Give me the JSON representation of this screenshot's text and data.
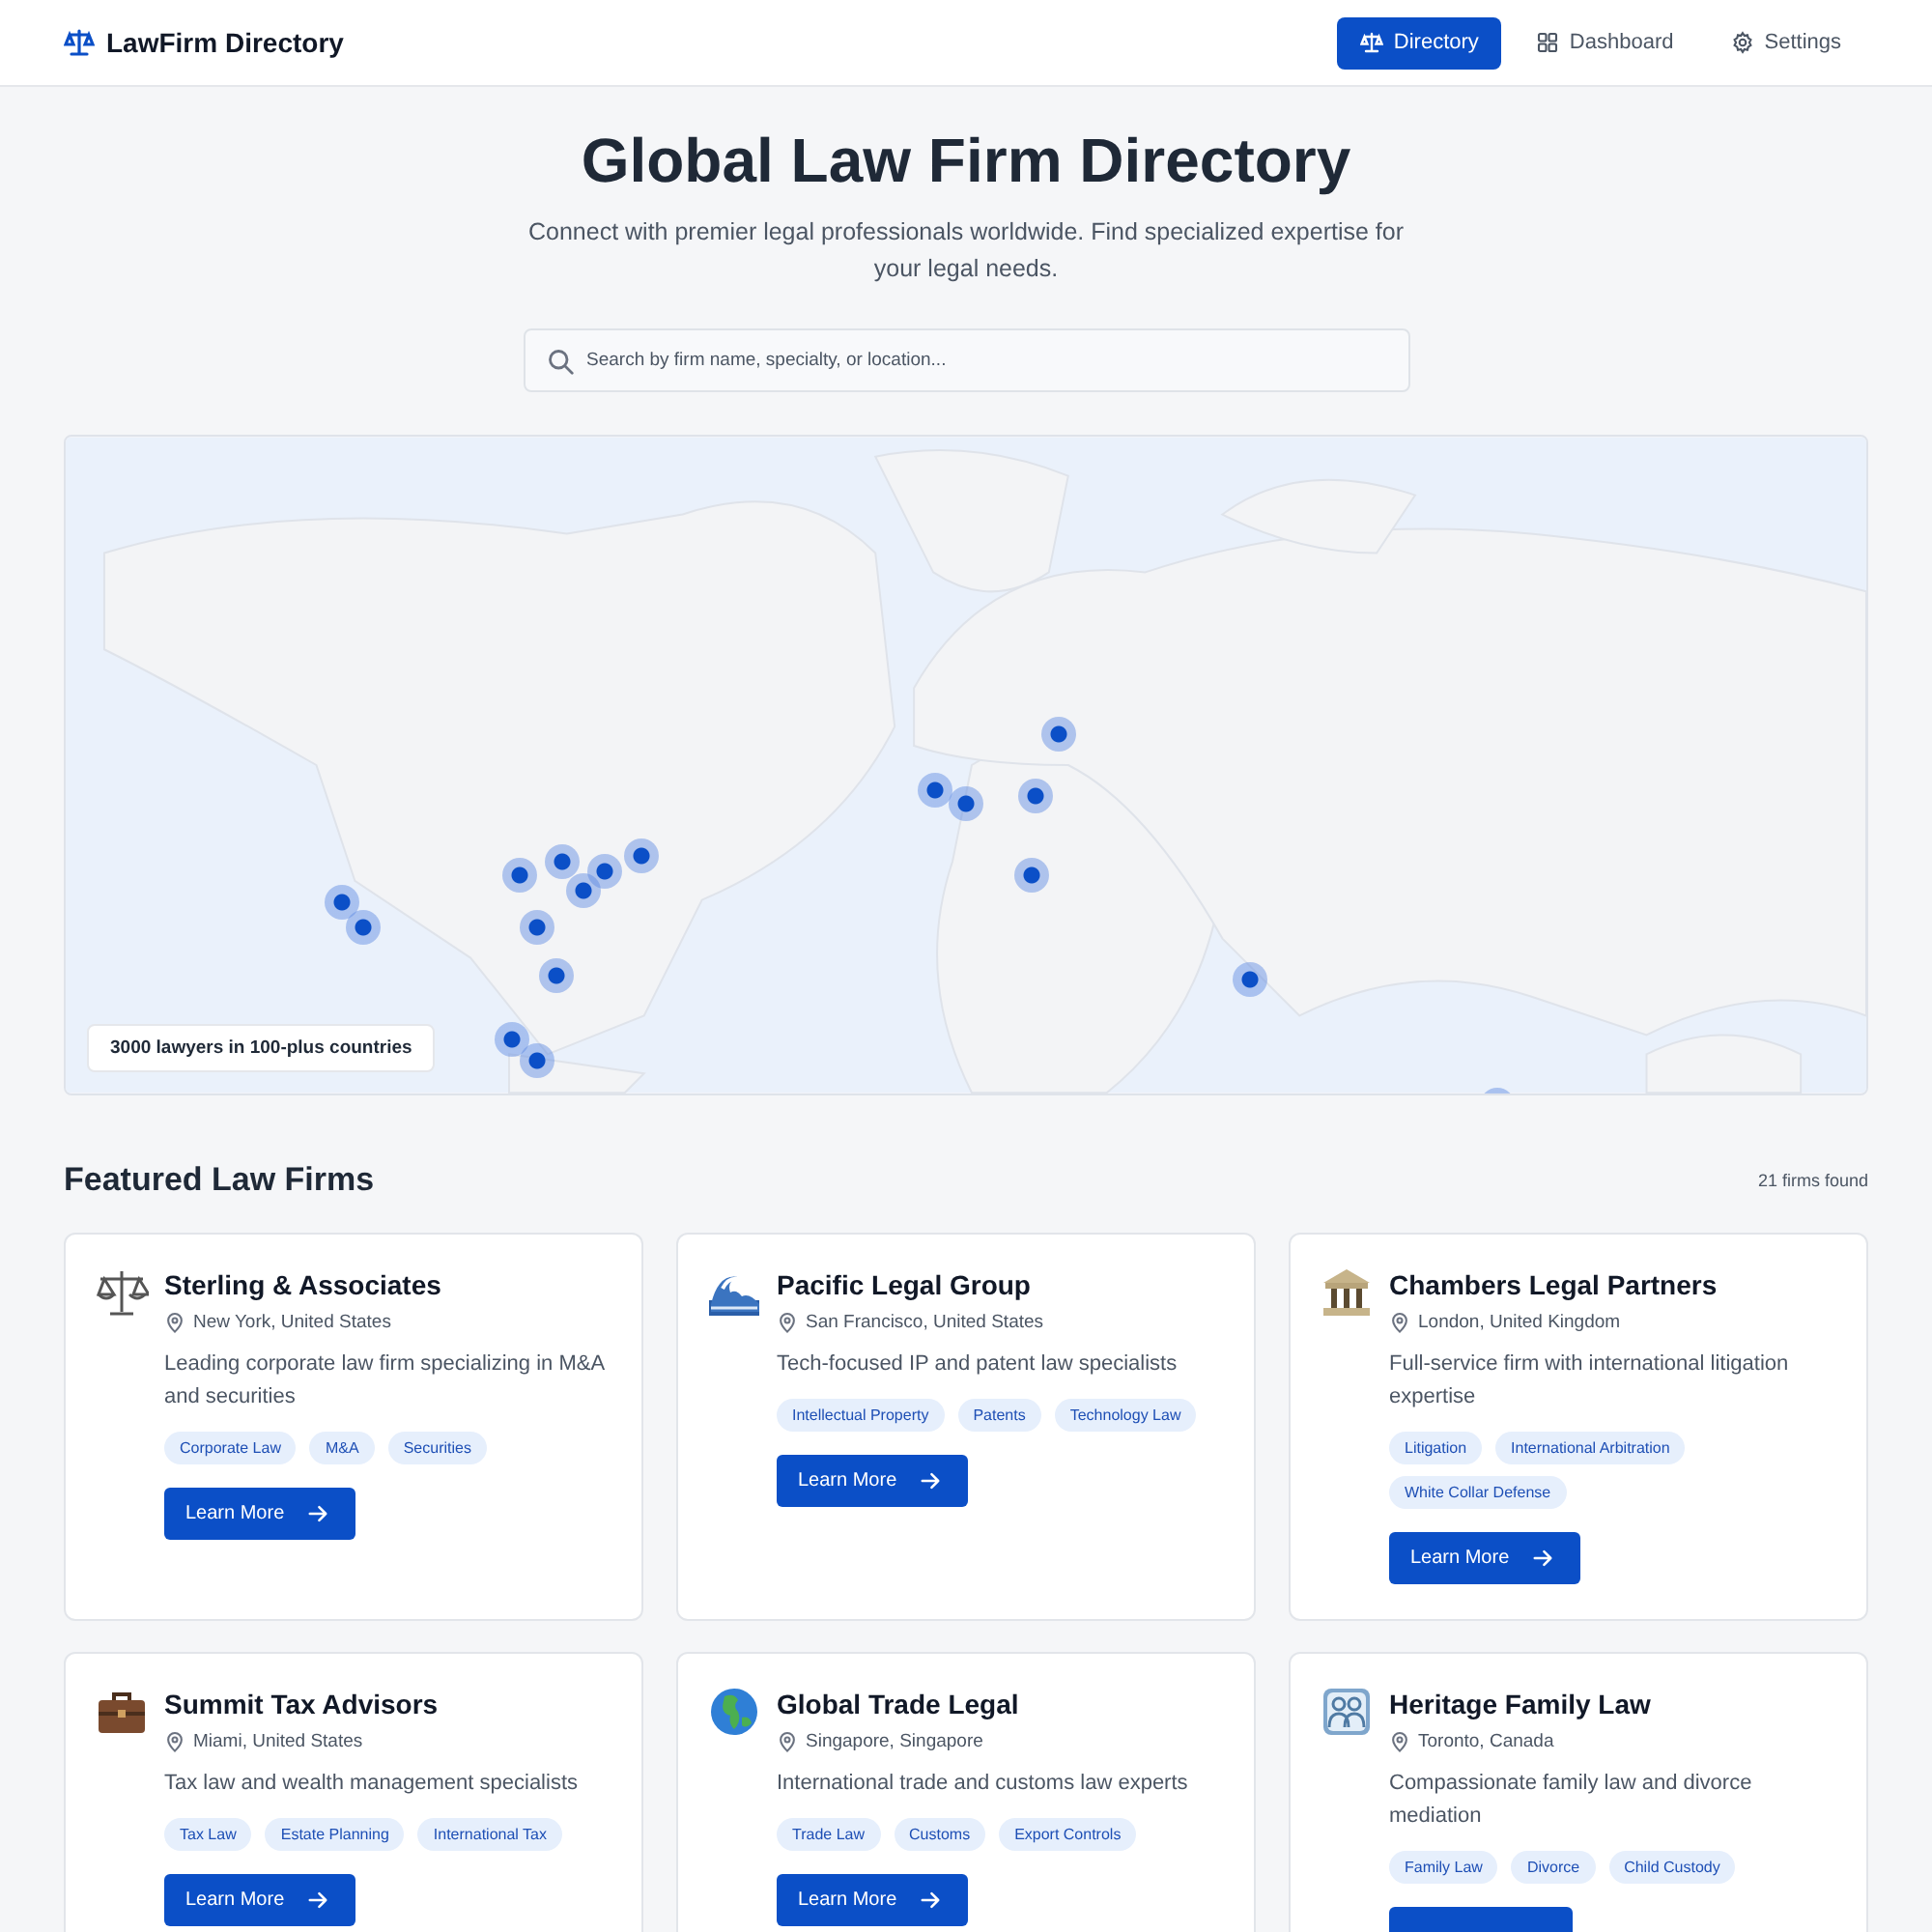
{
  "header": {
    "brand": "LawFirm Directory",
    "nav": [
      {
        "label": "Directory",
        "selected": true
      },
      {
        "label": "Dashboard",
        "selected": false
      },
      {
        "label": "Settings",
        "selected": false
      }
    ]
  },
  "hero": {
    "title": "Global Law Firm Directory",
    "subtitle": "Connect with premier legal professionals worldwide. Find specialized expertise for your legal needs."
  },
  "search": {
    "placeholder": "Search by firm name, specialty, or location..."
  },
  "map": {
    "kind": "picture",
    "caption": "3000 lawyers in 100-plus countries"
  },
  "featured": {
    "title": "Featured Law Firms",
    "count": "21 firms found"
  },
  "firms": [
    {
      "name": "Sterling & Associates",
      "location": "New York, United States",
      "description": "Leading corporate law firm specializing in M&A and securities",
      "tags": [
        "Corporate Law",
        "M&A",
        "Securities"
      ],
      "button": "Learn More"
    },
    {
      "name": "Pacific Legal Group",
      "location": "San Francisco, United States",
      "description": "Tech-focused IP and patent law specialists",
      "tags": [
        "Intellectual Property",
        "Patents",
        "Technology Law"
      ],
      "button": "Learn More"
    },
    {
      "name": "Chambers Legal Partners",
      "location": "London, United Kingdom",
      "description": "Full-service firm with international litigation expertise",
      "tags": [
        "Litigation",
        "International Arbitration",
        "White Collar Defense"
      ],
      "button": "Learn More"
    },
    {
      "name": "Summit Tax Advisors",
      "location": "Miami, United States",
      "description": "Tax law and wealth management specialists",
      "tags": [
        "Tax Law",
        "Estate Planning",
        "International Tax"
      ],
      "button": "Learn More"
    },
    {
      "name": "Global Trade Legal",
      "location": "Singapore, Singapore",
      "description": "International trade and customs law experts",
      "tags": [
        "Trade Law",
        "Customs",
        "Export Controls"
      ],
      "button": "Learn More"
    },
    {
      "name": "Heritage Family Law",
      "location": "Toronto, Canada",
      "description": "Compassionate family law and divorce mediation",
      "tags": [
        "Family Law",
        "Divorce",
        "Child Custody"
      ]
    }
  ]
}
